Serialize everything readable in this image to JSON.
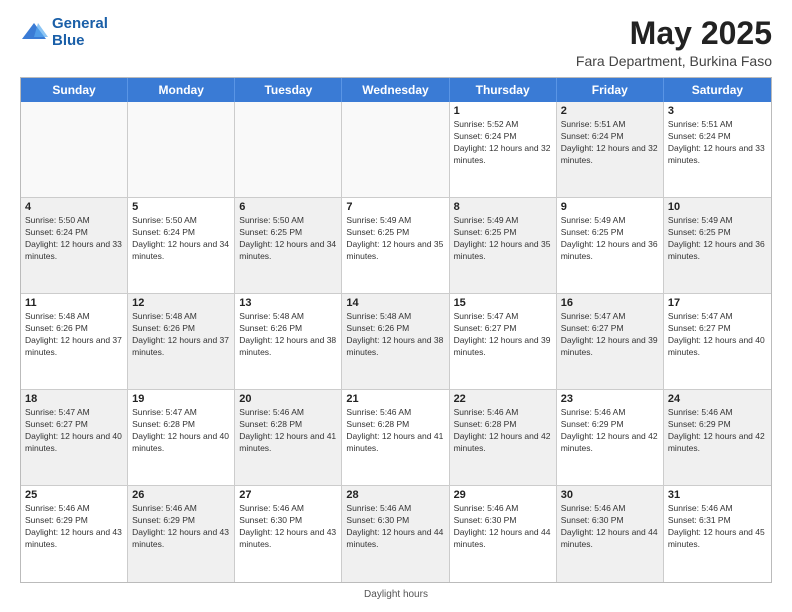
{
  "logo": {
    "line1": "General",
    "line2": "Blue"
  },
  "title": "May 2025",
  "subtitle": "Fara Department, Burkina Faso",
  "days_of_week": [
    "Sunday",
    "Monday",
    "Tuesday",
    "Wednesday",
    "Thursday",
    "Friday",
    "Saturday"
  ],
  "footer": "Daylight hours",
  "weeks": [
    [
      {
        "day": "",
        "empty": true
      },
      {
        "day": "",
        "empty": true
      },
      {
        "day": "",
        "empty": true
      },
      {
        "day": "",
        "empty": true
      },
      {
        "day": "1",
        "sunrise": "5:52 AM",
        "sunset": "6:24 PM",
        "daylight": "12 hours and 32 minutes.",
        "shaded": false
      },
      {
        "day": "2",
        "sunrise": "5:51 AM",
        "sunset": "6:24 PM",
        "daylight": "12 hours and 32 minutes.",
        "shaded": true
      },
      {
        "day": "3",
        "sunrise": "5:51 AM",
        "sunset": "6:24 PM",
        "daylight": "12 hours and 33 minutes.",
        "shaded": false
      }
    ],
    [
      {
        "day": "4",
        "sunrise": "5:50 AM",
        "sunset": "6:24 PM",
        "daylight": "12 hours and 33 minutes.",
        "shaded": true
      },
      {
        "day": "5",
        "sunrise": "5:50 AM",
        "sunset": "6:24 PM",
        "daylight": "12 hours and 34 minutes.",
        "shaded": false
      },
      {
        "day": "6",
        "sunrise": "5:50 AM",
        "sunset": "6:25 PM",
        "daylight": "12 hours and 34 minutes.",
        "shaded": true
      },
      {
        "day": "7",
        "sunrise": "5:49 AM",
        "sunset": "6:25 PM",
        "daylight": "12 hours and 35 minutes.",
        "shaded": false
      },
      {
        "day": "8",
        "sunrise": "5:49 AM",
        "sunset": "6:25 PM",
        "daylight": "12 hours and 35 minutes.",
        "shaded": true
      },
      {
        "day": "9",
        "sunrise": "5:49 AM",
        "sunset": "6:25 PM",
        "daylight": "12 hours and 36 minutes.",
        "shaded": false
      },
      {
        "day": "10",
        "sunrise": "5:49 AM",
        "sunset": "6:25 PM",
        "daylight": "12 hours and 36 minutes.",
        "shaded": true
      }
    ],
    [
      {
        "day": "11",
        "sunrise": "5:48 AM",
        "sunset": "6:26 PM",
        "daylight": "12 hours and 37 minutes.",
        "shaded": false
      },
      {
        "day": "12",
        "sunrise": "5:48 AM",
        "sunset": "6:26 PM",
        "daylight": "12 hours and 37 minutes.",
        "shaded": true
      },
      {
        "day": "13",
        "sunrise": "5:48 AM",
        "sunset": "6:26 PM",
        "daylight": "12 hours and 38 minutes.",
        "shaded": false
      },
      {
        "day": "14",
        "sunrise": "5:48 AM",
        "sunset": "6:26 PM",
        "daylight": "12 hours and 38 minutes.",
        "shaded": true
      },
      {
        "day": "15",
        "sunrise": "5:47 AM",
        "sunset": "6:27 PM",
        "daylight": "12 hours and 39 minutes.",
        "shaded": false
      },
      {
        "day": "16",
        "sunrise": "5:47 AM",
        "sunset": "6:27 PM",
        "daylight": "12 hours and 39 minutes.",
        "shaded": true
      },
      {
        "day": "17",
        "sunrise": "5:47 AM",
        "sunset": "6:27 PM",
        "daylight": "12 hours and 40 minutes.",
        "shaded": false
      }
    ],
    [
      {
        "day": "18",
        "sunrise": "5:47 AM",
        "sunset": "6:27 PM",
        "daylight": "12 hours and 40 minutes.",
        "shaded": true
      },
      {
        "day": "19",
        "sunrise": "5:47 AM",
        "sunset": "6:28 PM",
        "daylight": "12 hours and 40 minutes.",
        "shaded": false
      },
      {
        "day": "20",
        "sunrise": "5:46 AM",
        "sunset": "6:28 PM",
        "daylight": "12 hours and 41 minutes.",
        "shaded": true
      },
      {
        "day": "21",
        "sunrise": "5:46 AM",
        "sunset": "6:28 PM",
        "daylight": "12 hours and 41 minutes.",
        "shaded": false
      },
      {
        "day": "22",
        "sunrise": "5:46 AM",
        "sunset": "6:28 PM",
        "daylight": "12 hours and 42 minutes.",
        "shaded": true
      },
      {
        "day": "23",
        "sunrise": "5:46 AM",
        "sunset": "6:29 PM",
        "daylight": "12 hours and 42 minutes.",
        "shaded": false
      },
      {
        "day": "24",
        "sunrise": "5:46 AM",
        "sunset": "6:29 PM",
        "daylight": "12 hours and 42 minutes.",
        "shaded": true
      }
    ],
    [
      {
        "day": "25",
        "sunrise": "5:46 AM",
        "sunset": "6:29 PM",
        "daylight": "12 hours and 43 minutes.",
        "shaded": false
      },
      {
        "day": "26",
        "sunrise": "5:46 AM",
        "sunset": "6:29 PM",
        "daylight": "12 hours and 43 minutes.",
        "shaded": true
      },
      {
        "day": "27",
        "sunrise": "5:46 AM",
        "sunset": "6:30 PM",
        "daylight": "12 hours and 43 minutes.",
        "shaded": false
      },
      {
        "day": "28",
        "sunrise": "5:46 AM",
        "sunset": "6:30 PM",
        "daylight": "12 hours and 44 minutes.",
        "shaded": true
      },
      {
        "day": "29",
        "sunrise": "5:46 AM",
        "sunset": "6:30 PM",
        "daylight": "12 hours and 44 minutes.",
        "shaded": false
      },
      {
        "day": "30",
        "sunrise": "5:46 AM",
        "sunset": "6:30 PM",
        "daylight": "12 hours and 44 minutes.",
        "shaded": true
      },
      {
        "day": "31",
        "sunrise": "5:46 AM",
        "sunset": "6:31 PM",
        "daylight": "12 hours and 45 minutes.",
        "shaded": false
      }
    ]
  ]
}
